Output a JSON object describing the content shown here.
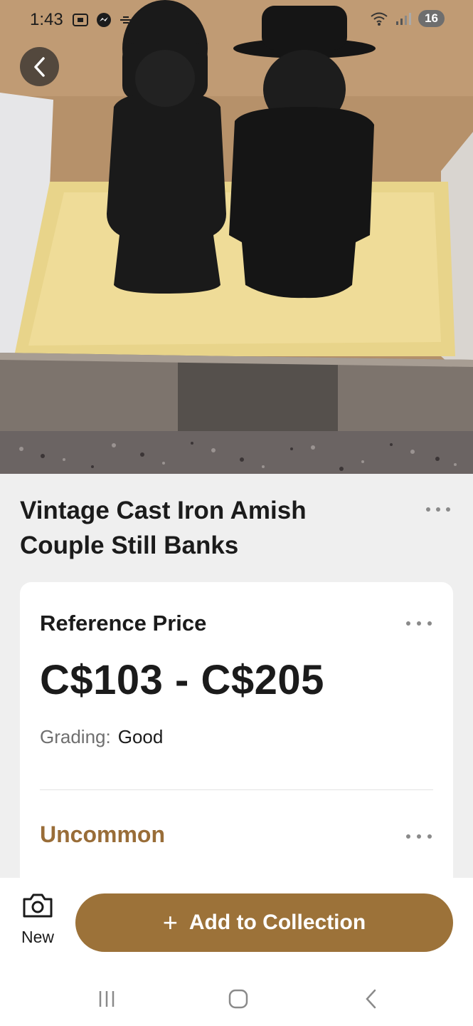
{
  "status_bar": {
    "time": "1:43",
    "battery": "16",
    "left_icons": [
      "screenshot-icon",
      "messenger-icon",
      "signal-arrows-icon"
    ]
  },
  "hero": {
    "image_description_icon": "product-photo"
  },
  "item": {
    "title": "Vintage Cast Iron Amish Couple Still Banks"
  },
  "price_card": {
    "heading": "Reference Price",
    "price_range": "C$103 - C$205",
    "grading_label": "Grading:",
    "grading_value": "Good",
    "rarity": "Uncommon"
  },
  "actions": {
    "new_label": "New",
    "add_label": "Add to Collection",
    "add_icon": "+"
  },
  "colors": {
    "accent": "#9c7239",
    "rarity_text": "#996d38",
    "background": "#efefef",
    "card": "#ffffff"
  }
}
